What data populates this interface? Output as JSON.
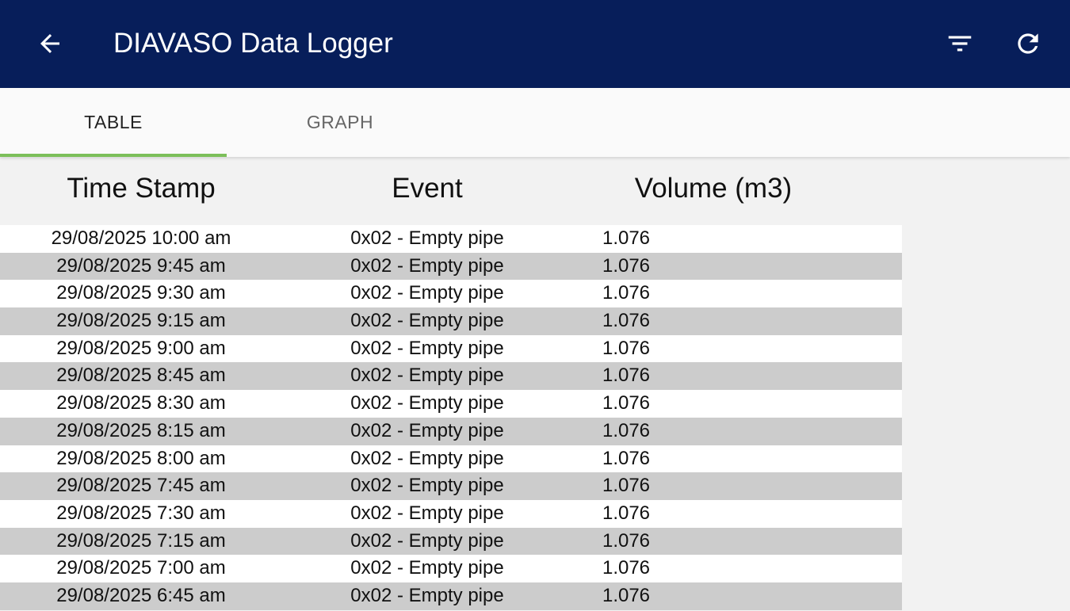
{
  "appbar": {
    "title": "DIAVASO Data Logger",
    "back_icon": "arrow-left-icon",
    "filter_icon": "filter-icon",
    "refresh_icon": "refresh-icon",
    "background": "#071e5a"
  },
  "tabs": [
    {
      "label": "TABLE",
      "active": true
    },
    {
      "label": "GRAPH",
      "active": false
    }
  ],
  "accent": "#7cbf5a",
  "table": {
    "headers": [
      "Time Stamp",
      "Event",
      "Volume (m3)"
    ],
    "rows": [
      {
        "time": "29/08/2025 10:00 am",
        "event": "0x02 - Empty pipe",
        "volume": "1.076"
      },
      {
        "time": "29/08/2025 9:45 am",
        "event": "0x02 - Empty pipe",
        "volume": "1.076"
      },
      {
        "time": "29/08/2025 9:30 am",
        "event": "0x02 - Empty pipe",
        "volume": "1.076"
      },
      {
        "time": "29/08/2025 9:15 am",
        "event": "0x02 - Empty pipe",
        "volume": "1.076"
      },
      {
        "time": "29/08/2025 9:00 am",
        "event": "0x02 - Empty pipe",
        "volume": "1.076"
      },
      {
        "time": "29/08/2025 8:45 am",
        "event": "0x02 - Empty pipe",
        "volume": "1.076"
      },
      {
        "time": "29/08/2025 8:30 am",
        "event": "0x02 - Empty pipe",
        "volume": "1.076"
      },
      {
        "time": "29/08/2025 8:15 am",
        "event": "0x02 - Empty pipe",
        "volume": "1.076"
      },
      {
        "time": "29/08/2025 8:00 am",
        "event": "0x02 - Empty pipe",
        "volume": "1.076"
      },
      {
        "time": "29/08/2025 7:45 am",
        "event": "0x02 - Empty pipe",
        "volume": "1.076"
      },
      {
        "time": "29/08/2025 7:30 am",
        "event": "0x02 - Empty pipe",
        "volume": "1.076"
      },
      {
        "time": "29/08/2025 7:15 am",
        "event": "0x02 - Empty pipe",
        "volume": "1.076"
      },
      {
        "time": "29/08/2025 7:00 am",
        "event": "0x02 - Empty pipe",
        "volume": "1.076"
      },
      {
        "time": "29/08/2025 6:45 am",
        "event": "0x02 - Empty pipe",
        "volume": "1.076"
      }
    ]
  }
}
